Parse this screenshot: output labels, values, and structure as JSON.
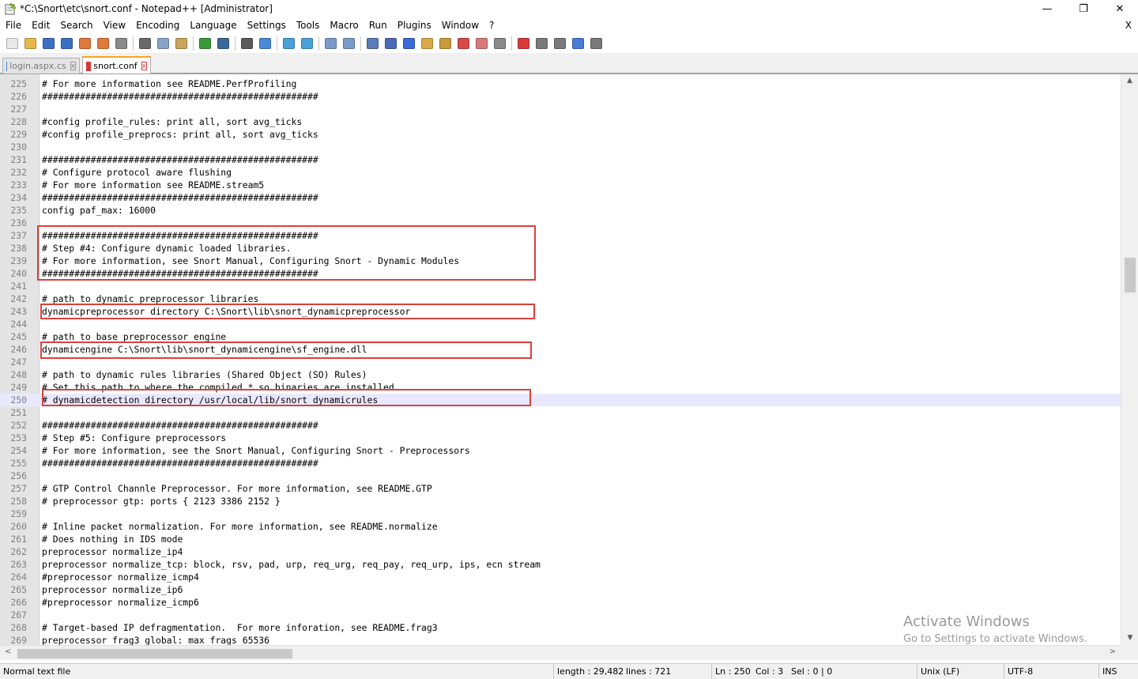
{
  "window": {
    "title": "*C:\\Snort\\etc\\snort.conf - Notepad++ [Administrator]",
    "minimize": "—",
    "restore": "❐",
    "close": "✕"
  },
  "menu": {
    "items": [
      "File",
      "Edit",
      "Search",
      "View",
      "Encoding",
      "Language",
      "Settings",
      "Tools",
      "Macro",
      "Run",
      "Plugins",
      "Window",
      "?"
    ],
    "close_doc": "X"
  },
  "toolbar": {
    "buttons": [
      {
        "name": "new-file-icon",
        "color": "#e8e8e8"
      },
      {
        "name": "open-file-icon",
        "color": "#e6b84a"
      },
      {
        "name": "save-icon",
        "color": "#3a6fc4"
      },
      {
        "name": "save-all-icon",
        "color": "#3a6fc4"
      },
      {
        "name": "close-icon",
        "color": "#e07a3a"
      },
      {
        "name": "close-all-icon",
        "color": "#e07a3a"
      },
      {
        "name": "print-icon",
        "color": "#8a8a8a"
      },
      {
        "sep": true
      },
      {
        "name": "cut-icon",
        "color": "#6a6a6a"
      },
      {
        "name": "copy-icon",
        "color": "#8aa4c8"
      },
      {
        "name": "paste-icon",
        "color": "#c9a45a"
      },
      {
        "sep": true
      },
      {
        "name": "undo-icon",
        "color": "#3a9a3a"
      },
      {
        "name": "redo-icon",
        "color": "#3a6a9a"
      },
      {
        "sep": true
      },
      {
        "name": "find-icon",
        "color": "#5a5a5a"
      },
      {
        "name": "replace-icon",
        "color": "#4a8ad8"
      },
      {
        "sep": true
      },
      {
        "name": "zoom-in-icon",
        "color": "#4aa0d8"
      },
      {
        "name": "zoom-out-icon",
        "color": "#4aa0d8"
      },
      {
        "sep": true
      },
      {
        "name": "sync-vertical-icon",
        "color": "#7a9ac8"
      },
      {
        "name": "sync-horizontal-icon",
        "color": "#7a9ac8"
      },
      {
        "sep": true
      },
      {
        "name": "word-wrap-icon",
        "color": "#5a7ab8"
      },
      {
        "name": "show-all-chars-icon",
        "color": "#4a6ab8"
      },
      {
        "name": "indent-guide-icon",
        "color": "#3a6ad8"
      },
      {
        "name": "doc-map-icon",
        "color": "#d8a84a"
      },
      {
        "name": "function-list-icon",
        "color": "#c89a3a"
      },
      {
        "name": "folder-workspace-icon",
        "color": "#d84a4a"
      },
      {
        "name": "monitoring-icon",
        "color": "#d87a7a"
      },
      {
        "name": "view-icon",
        "color": "#8a8a8a"
      },
      {
        "sep": true
      },
      {
        "name": "record-macro-icon",
        "color": "#d83a3a"
      },
      {
        "name": "stop-record-icon",
        "color": "#7a7a7a"
      },
      {
        "name": "play-macro-icon",
        "color": "#7a7a7a"
      },
      {
        "name": "play-multiple-icon",
        "color": "#4a7ad8"
      },
      {
        "name": "save-macro-icon",
        "color": "#7a7a7a"
      }
    ]
  },
  "tabs": [
    {
      "label": "login.aspx.cs",
      "close": "x",
      "active": false
    },
    {
      "label": "snort.conf",
      "close": "x",
      "active": true
    }
  ],
  "editor": {
    "lines": [
      {
        "n": "225",
        "text": "# For more information see README.PerfProfiling"
      },
      {
        "n": "226",
        "text": "###################################################"
      },
      {
        "n": "227",
        "text": ""
      },
      {
        "n": "228",
        "text": "#config profile_rules: print all, sort avg_ticks"
      },
      {
        "n": "229",
        "text": "#config profile_preprocs: print all, sort avg_ticks"
      },
      {
        "n": "230",
        "text": ""
      },
      {
        "n": "231",
        "text": "###################################################"
      },
      {
        "n": "232",
        "text": "# Configure protocol aware flushing"
      },
      {
        "n": "233",
        "text": "# For more information see README.stream5"
      },
      {
        "n": "234",
        "text": "###################################################"
      },
      {
        "n": "235",
        "text": "config paf_max: 16000"
      },
      {
        "n": "236",
        "text": ""
      },
      {
        "n": "237",
        "text": "###################################################"
      },
      {
        "n": "238",
        "text": "# Step #4: Configure dynamic loaded libraries."
      },
      {
        "n": "239",
        "text": "# For more information, see Snort Manual, Configuring Snort - Dynamic Modules"
      },
      {
        "n": "240",
        "text": "###################################################"
      },
      {
        "n": "241",
        "text": ""
      },
      {
        "n": "242",
        "text": "# path to dynamic preprocessor libraries"
      },
      {
        "n": "243",
        "text": "dynamicpreprocessor directory C:\\Snort\\lib\\snort_dynamicpreprocessor"
      },
      {
        "n": "244",
        "text": ""
      },
      {
        "n": "245",
        "text": "# path to base preprocessor engine"
      },
      {
        "n": "246",
        "text": "dynamicengine C:\\Snort\\lib\\snort_dynamicengine\\sf_engine.dll"
      },
      {
        "n": "247",
        "text": ""
      },
      {
        "n": "248",
        "text": "# path to dynamic rules libraries (Shared Object (SO) Rules)"
      },
      {
        "n": "249",
        "text": "# Set this path to where the compiled *.so binaries are installed"
      },
      {
        "n": "250",
        "text": "# dynamicdetection directory /usr/local/lib/snort_dynamicrules"
      },
      {
        "n": "251",
        "text": ""
      },
      {
        "n": "252",
        "text": "###################################################"
      },
      {
        "n": "253",
        "text": "# Step #5: Configure preprocessors"
      },
      {
        "n": "254",
        "text": "# For more information, see the Snort Manual, Configuring Snort - Preprocessors"
      },
      {
        "n": "255",
        "text": "###################################################"
      },
      {
        "n": "256",
        "text": ""
      },
      {
        "n": "257",
        "text": "# GTP Control Channle Preprocessor. For more information, see README.GTP"
      },
      {
        "n": "258",
        "text": "# preprocessor gtp: ports { 2123 3386 2152 }"
      },
      {
        "n": "259",
        "text": ""
      },
      {
        "n": "260",
        "text": "# Inline packet normalization. For more information, see README.normalize"
      },
      {
        "n": "261",
        "text": "# Does nothing in IDS mode"
      },
      {
        "n": "262",
        "text": "preprocessor normalize_ip4"
      },
      {
        "n": "263",
        "text": "preprocessor normalize_tcp: block, rsv, pad, urp, req_urg, req_pay, req_urp, ips, ecn stream"
      },
      {
        "n": "264",
        "text": "#preprocessor normalize_icmp4"
      },
      {
        "n": "265",
        "text": "preprocessor normalize_ip6"
      },
      {
        "n": "266",
        "text": "#preprocessor normalize_icmp6"
      },
      {
        "n": "267",
        "text": ""
      },
      {
        "n": "268",
        "text": "# Target-based IP defragmentation.  For more inforation, see README.frag3"
      },
      {
        "n": "269",
        "text": "preprocessor frag3_global: max_frags 65536"
      }
    ],
    "current_line": "250",
    "highlight_color": "#d9413a",
    "current_line_color": "#e8e8ff"
  },
  "scrollbars": {
    "up": "▲",
    "down": "▼",
    "left": "<",
    "right": ">"
  },
  "watermark": {
    "line1": "Activate Windows",
    "line2": "Go to Settings to activate Windows."
  },
  "status": {
    "file_type": "Normal text file",
    "length": "length : 29,482",
    "lines": "lines : 721",
    "ln": "Ln : 250",
    "col": "Col : 3",
    "sel": "Sel : 0 | 0",
    "eol": "Unix (LF)",
    "encoding": "UTF-8",
    "mode": "INS"
  }
}
